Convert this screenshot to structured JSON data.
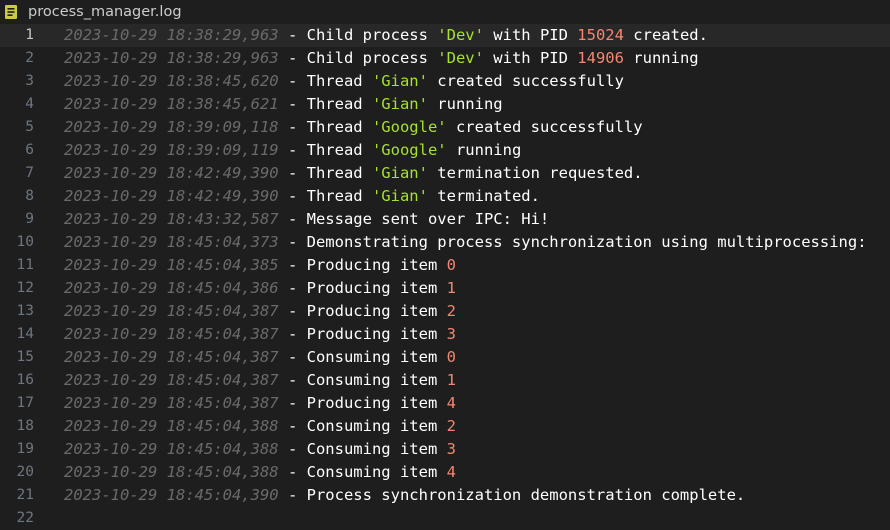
{
  "tab": {
    "icon": "log-file-icon",
    "title": "process_manager.log"
  },
  "colors": {
    "background": "#1e1e1e",
    "timestamp": "#6a6a6a",
    "text": "#ffffff",
    "string": "#a6e22e",
    "string_quote": "#ce9178",
    "number": "#f48771",
    "line_number": "#6e7681"
  },
  "lines": [
    {
      "n": "1",
      "ts": "2023-10-29 18:38:29,963",
      "segs": [
        {
          "t": "txt",
          "v": " - Child process "
        },
        {
          "t": "str",
          "v": "'Dev'"
        },
        {
          "t": "txt",
          "v": " with PID "
        },
        {
          "t": "num",
          "v": "15024"
        },
        {
          "t": "txt",
          "v": " created."
        }
      ]
    },
    {
      "n": "2",
      "ts": "2023-10-29 18:38:29,963",
      "segs": [
        {
          "t": "txt",
          "v": " - Child process "
        },
        {
          "t": "str",
          "v": "'Dev'"
        },
        {
          "t": "txt",
          "v": " with PID "
        },
        {
          "t": "num",
          "v": "14906"
        },
        {
          "t": "txt",
          "v": " running"
        }
      ]
    },
    {
      "n": "3",
      "ts": "2023-10-29 18:38:45,620",
      "segs": [
        {
          "t": "txt",
          "v": " - Thread "
        },
        {
          "t": "str",
          "v": "'Gian'"
        },
        {
          "t": "txt",
          "v": " created successfully"
        }
      ]
    },
    {
      "n": "4",
      "ts": "2023-10-29 18:38:45,621",
      "segs": [
        {
          "t": "txt",
          "v": " - Thread "
        },
        {
          "t": "str",
          "v": "'Gian'"
        },
        {
          "t": "txt",
          "v": " running"
        }
      ]
    },
    {
      "n": "5",
      "ts": "2023-10-29 18:39:09,118",
      "segs": [
        {
          "t": "txt",
          "v": " - Thread "
        },
        {
          "t": "str",
          "v": "'Google'"
        },
        {
          "t": "txt",
          "v": " created successfully"
        }
      ]
    },
    {
      "n": "6",
      "ts": "2023-10-29 18:39:09,119",
      "segs": [
        {
          "t": "txt",
          "v": " - Thread "
        },
        {
          "t": "str",
          "v": "'Google'"
        },
        {
          "t": "txt",
          "v": " running"
        }
      ]
    },
    {
      "n": "7",
      "ts": "2023-10-29 18:42:49,390",
      "segs": [
        {
          "t": "txt",
          "v": " - Thread "
        },
        {
          "t": "str",
          "v": "'Gian'"
        },
        {
          "t": "txt",
          "v": " termination requested."
        }
      ]
    },
    {
      "n": "8",
      "ts": "2023-10-29 18:42:49,390",
      "segs": [
        {
          "t": "txt",
          "v": " - Thread "
        },
        {
          "t": "str",
          "v": "'Gian'"
        },
        {
          "t": "txt",
          "v": " terminated."
        }
      ]
    },
    {
      "n": "9",
      "ts": "2023-10-29 18:43:32,587",
      "segs": [
        {
          "t": "txt",
          "v": " - Message sent over IPC: Hi!"
        }
      ]
    },
    {
      "n": "10",
      "ts": "2023-10-29 18:45:04,373",
      "segs": [
        {
          "t": "txt",
          "v": " - Demonstrating process synchronization using multiprocessing:"
        }
      ]
    },
    {
      "n": "11",
      "ts": "2023-10-29 18:45:04,385",
      "segs": [
        {
          "t": "txt",
          "v": " - Producing item "
        },
        {
          "t": "num",
          "v": "0"
        }
      ]
    },
    {
      "n": "12",
      "ts": "2023-10-29 18:45:04,386",
      "segs": [
        {
          "t": "txt",
          "v": " - Producing item "
        },
        {
          "t": "num",
          "v": "1"
        }
      ]
    },
    {
      "n": "13",
      "ts": "2023-10-29 18:45:04,387",
      "segs": [
        {
          "t": "txt",
          "v": " - Producing item "
        },
        {
          "t": "num",
          "v": "2"
        }
      ]
    },
    {
      "n": "14",
      "ts": "2023-10-29 18:45:04,387",
      "segs": [
        {
          "t": "txt",
          "v": " - Producing item "
        },
        {
          "t": "num",
          "v": "3"
        }
      ]
    },
    {
      "n": "15",
      "ts": "2023-10-29 18:45:04,387",
      "segs": [
        {
          "t": "txt",
          "v": " - Consuming item "
        },
        {
          "t": "num",
          "v": "0"
        }
      ]
    },
    {
      "n": "16",
      "ts": "2023-10-29 18:45:04,387",
      "segs": [
        {
          "t": "txt",
          "v": " - Consuming item "
        },
        {
          "t": "num",
          "v": "1"
        }
      ]
    },
    {
      "n": "17",
      "ts": "2023-10-29 18:45:04,387",
      "segs": [
        {
          "t": "txt",
          "v": " - Producing item "
        },
        {
          "t": "num",
          "v": "4"
        }
      ]
    },
    {
      "n": "18",
      "ts": "2023-10-29 18:45:04,388",
      "segs": [
        {
          "t": "txt",
          "v": " - Consuming item "
        },
        {
          "t": "num",
          "v": "2"
        }
      ]
    },
    {
      "n": "19",
      "ts": "2023-10-29 18:45:04,388",
      "segs": [
        {
          "t": "txt",
          "v": " - Consuming item "
        },
        {
          "t": "num",
          "v": "3"
        }
      ]
    },
    {
      "n": "20",
      "ts": "2023-10-29 18:45:04,388",
      "segs": [
        {
          "t": "txt",
          "v": " - Consuming item "
        },
        {
          "t": "num",
          "v": "4"
        }
      ]
    },
    {
      "n": "21",
      "ts": "2023-10-29 18:45:04,390",
      "segs": [
        {
          "t": "txt",
          "v": " - Process synchronization demonstration complete."
        }
      ]
    },
    {
      "n": "22",
      "ts": "",
      "segs": []
    }
  ],
  "active_line": 1
}
